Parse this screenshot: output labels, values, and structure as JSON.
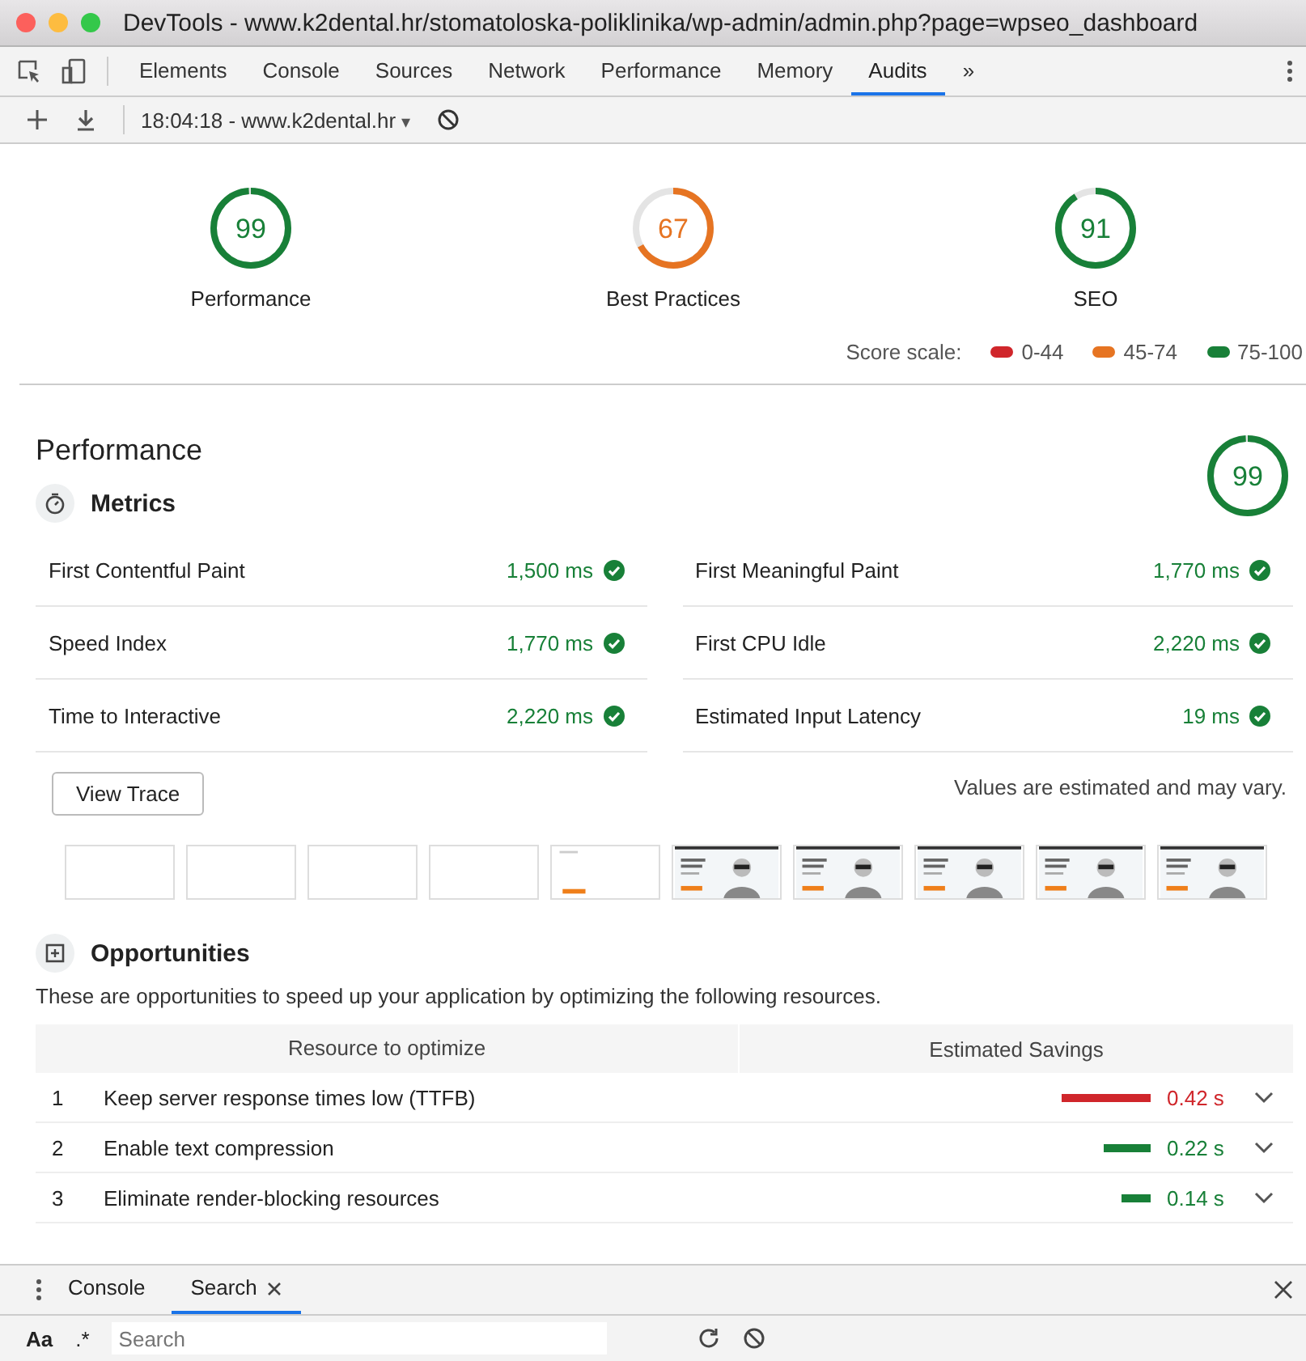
{
  "window": {
    "title": "DevTools - www.k2dental.hr/stomatoloska-poliklinika/wp-admin/admin.php?page=wpseo_dashboard"
  },
  "tabs": [
    {
      "label": "Elements",
      "selected": false
    },
    {
      "label": "Console",
      "selected": false
    },
    {
      "label": "Sources",
      "selected": false
    },
    {
      "label": "Network",
      "selected": false
    },
    {
      "label": "Performance",
      "selected": false
    },
    {
      "label": "Memory",
      "selected": false
    },
    {
      "label": "Audits",
      "selected": true
    }
  ],
  "tabs_more": "»",
  "toolbar": {
    "report": "18:04:18 - www.k2dental.hr",
    "caret": "▾"
  },
  "scores": [
    {
      "value": "99",
      "label": "Performance",
      "color": "#188038"
    },
    {
      "value": "67",
      "label": "Best Practices",
      "color": "#e67422"
    },
    {
      "value": "91",
      "label": "SEO",
      "color": "#188038"
    }
  ],
  "score_scale": {
    "label": "Score scale:",
    "ranges": [
      {
        "label": "0-44",
        "color": "#d0262b"
      },
      {
        "label": "45-74",
        "color": "#e67422"
      },
      {
        "label": "75-100",
        "color": "#188038"
      }
    ]
  },
  "performance": {
    "title": "Performance",
    "score": "99",
    "color": "#188038",
    "metrics_title": "Metrics",
    "metrics": [
      {
        "name": "First Contentful Paint",
        "value": "1,500 ms"
      },
      {
        "name": "First Meaningful Paint",
        "value": "1,770 ms"
      },
      {
        "name": "Speed Index",
        "value": "1,770 ms"
      },
      {
        "name": "First CPU Idle",
        "value": "2,220 ms"
      },
      {
        "name": "Time to Interactive",
        "value": "2,220 ms"
      },
      {
        "name": "Estimated Input Latency",
        "value": "19 ms"
      }
    ],
    "view_trace": "View Trace",
    "note": "Values are estimated and may vary.",
    "filmstrip": [
      {
        "kind": "blank"
      },
      {
        "kind": "blank"
      },
      {
        "kind": "blank"
      },
      {
        "kind": "blank"
      },
      {
        "kind": "partial"
      },
      {
        "kind": "picture"
      },
      {
        "kind": "picture"
      },
      {
        "kind": "picture"
      },
      {
        "kind": "picture"
      },
      {
        "kind": "picture"
      }
    ]
  },
  "opportunities": {
    "title": "Opportunities",
    "description": "These are opportunities to speed up your application by optimizing the following resources.",
    "columns": [
      "Resource to optimize",
      "Estimated Savings"
    ],
    "rows": [
      {
        "index": "1",
        "name": "Keep server response times low (TTFB)",
        "saving": "0.42 s",
        "color": "#d0262b"
      },
      {
        "index": "2",
        "name": "Enable text compression",
        "saving": "0.22 s",
        "color": "#188038"
      },
      {
        "index": "3",
        "name": "Eliminate render-blocking resources",
        "saving": "0.14 s",
        "color": "#188038"
      }
    ]
  },
  "drawer": {
    "tabs": [
      {
        "label": "Console",
        "selected": false
      },
      {
        "label": "Search",
        "selected": true
      }
    ],
    "case_toggle": "Aa",
    "regex_toggle": ".*",
    "search_placeholder": "Search"
  }
}
